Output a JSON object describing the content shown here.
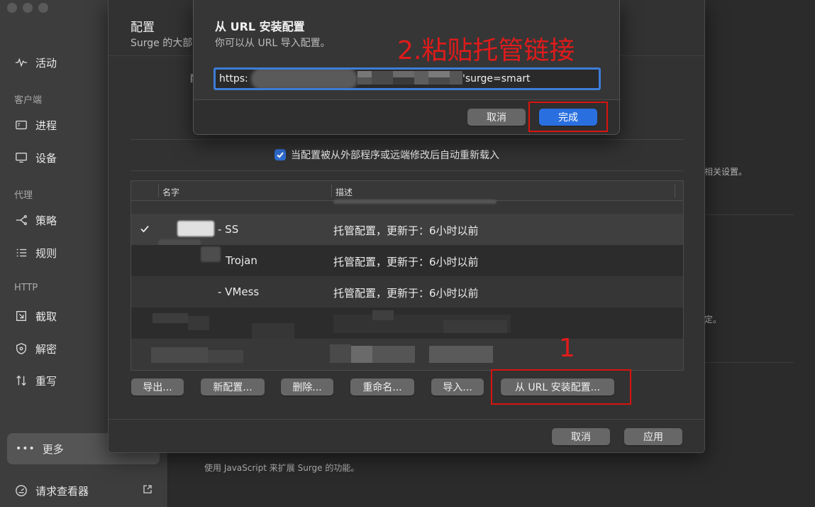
{
  "sidebar": {
    "activity": "活动",
    "section_client": "客户端",
    "process": "进程",
    "device": "设备",
    "section_proxy": "代理",
    "policy": "策略",
    "rules": "规则",
    "section_http": "HTTP",
    "capture": "截取",
    "decrypt": "解密",
    "rewrite": "重写",
    "more": "更多",
    "request_viewer": "请求查看器"
  },
  "background": {
    "frag_related": "相关设置。",
    "frag_ding": "定。",
    "js_desc": "使用 JavaScript 来扩展 Surge 的功能。"
  },
  "panel": {
    "title": "配置",
    "subtitle": "Surge 的大部",
    "frag": "配",
    "reload_checkbox_label": "当配置被从外部程序或远端修改后自动重新载入",
    "table": {
      "col_name": "名字",
      "col_desc": "描述",
      "rows": [
        {
          "name": "- SS",
          "desc": "托管配置，更新于：6小时以前",
          "selected": true
        },
        {
          "name": "Trojan",
          "desc": "托管配置，更新于：6小时以前",
          "selected": false
        },
        {
          "name": "- VMess",
          "desc": "托管配置，更新于：6小时以前",
          "selected": false
        }
      ]
    },
    "buttons": {
      "export": "导出...",
      "new": "新配置...",
      "delete": "删除...",
      "rename": "重命名...",
      "import": "导入...",
      "install_url": "从 URL 安装配置..."
    },
    "cancel": "取消",
    "apply": "应用"
  },
  "dialog": {
    "title": "从 URL 安装配置",
    "subtitle": "你可以从 URL 导入配置。",
    "url_prefix": "https:",
    "url_suffix": "'surge=smart",
    "cancel": "取消",
    "done": "完成"
  },
  "annotations": {
    "step1": "1",
    "step2": "2.粘贴托管链接"
  },
  "colors": {
    "accent": "#2a6fe0",
    "annotation_red": "#d9140f"
  }
}
